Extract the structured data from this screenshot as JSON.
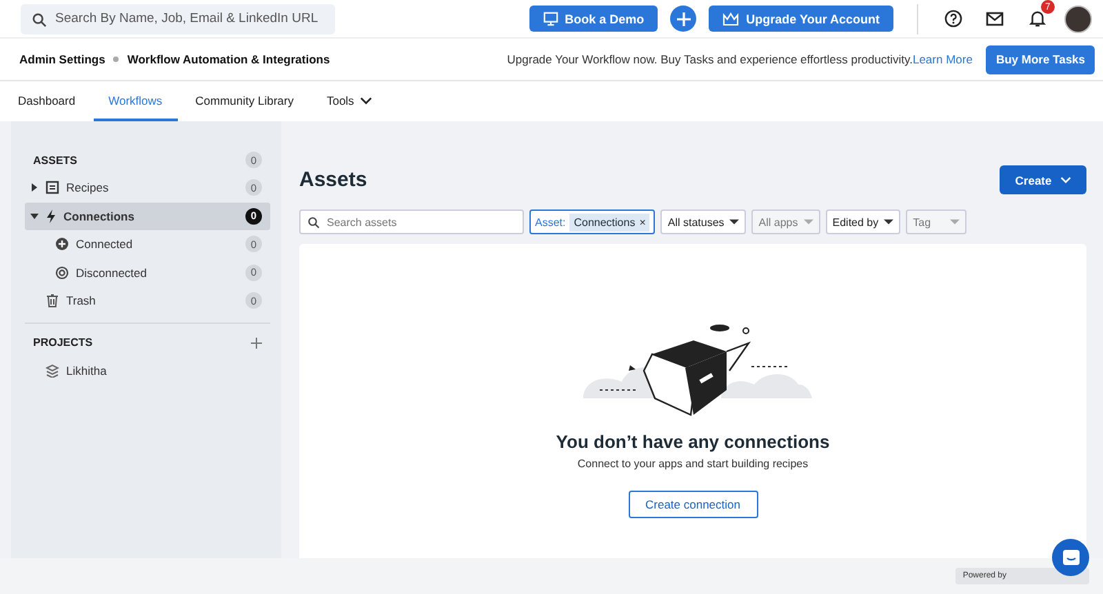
{
  "topbar": {
    "search": {
      "placeholder": "Search By Name, Job, Email & LinkedIn URL"
    },
    "demo_button": "Book a Demo",
    "upgrade_button": "Upgrade Your Account",
    "notification_count": "7"
  },
  "admin_bar": {
    "breadcrumbs": [
      "Admin Settings",
      "Workflow Automation & Integrations"
    ],
    "promo": "Upgrade Your Workflow now. Buy Tasks and experience effortless productivity.",
    "promo_link": "Learn More",
    "button": "Buy More Tasks"
  },
  "tabs": [
    {
      "label": "Dashboard",
      "selected": false,
      "has_menu": false
    },
    {
      "label": "Workflows",
      "selected": true,
      "has_menu": false
    },
    {
      "label": "Community Library",
      "selected": false,
      "has_menu": false
    },
    {
      "label": "Tools",
      "selected": false,
      "has_menu": true
    }
  ],
  "sidebar": {
    "assets_heading": "ASSETS",
    "assets_count": "0",
    "items": [
      {
        "kind": "recipes",
        "label": "Recipes",
        "count": "0",
        "expanded": false,
        "selected": false
      },
      {
        "kind": "connections",
        "label": "Connections",
        "count": "0",
        "expanded": true,
        "selected": true,
        "children": [
          {
            "kind": "connected",
            "label": "Connected",
            "count": "0",
            "selected": false
          },
          {
            "kind": "disconnected",
            "label": "Disconnected",
            "count": "0",
            "selected": false
          }
        ]
      },
      {
        "kind": "trash",
        "label": "Trash",
        "count": "0",
        "selected": false
      }
    ],
    "projects_heading": "PROJECTS",
    "projects": [
      {
        "label": "Likhitha"
      }
    ]
  },
  "content": {
    "title": "Assets",
    "create_button": "Create",
    "search": {
      "placeholder": "Search assets"
    },
    "chip": {
      "label": "Asset:",
      "value": "Connections",
      "remove": "×"
    },
    "filters": [
      {
        "label": "All statuses",
        "disabled": false
      },
      {
        "label": "All apps",
        "disabled": true
      },
      {
        "label": "Edited by",
        "disabled": false
      },
      {
        "label": "Tag",
        "disabled": true
      }
    ],
    "empty_title": "You don’t have any connections",
    "empty_text": "Connect to your apps and start building recipes",
    "empty_button": "Create connection"
  },
  "footer": {
    "powered_by": "Powered by"
  }
}
